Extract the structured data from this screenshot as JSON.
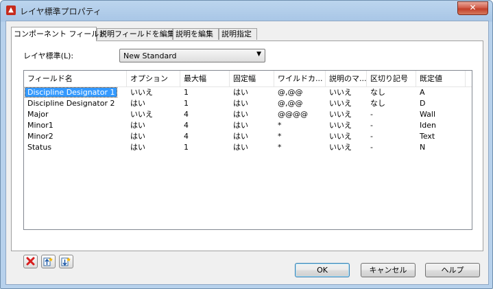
{
  "window": {
    "title": "レイヤ標準プロパティ",
    "close_label": "✕"
  },
  "tabs": [
    {
      "label": "コンポーネント フィールド",
      "active": true
    },
    {
      "label": "説明フィールドを編集",
      "active": false
    },
    {
      "label": "説明を編集",
      "active": false
    },
    {
      "label": "説明指定",
      "active": false
    }
  ],
  "layer_standard": {
    "label": "レイヤ標準(L):",
    "value": "New Standard"
  },
  "fields_table": {
    "columns": [
      "フィールド名",
      "オプション",
      "最大幅",
      "固定幅",
      "ワイルドカ...",
      "説明のマ...",
      "区切り記号",
      "既定値"
    ],
    "rows": [
      [
        "Discipline Designator 1",
        "いいえ",
        "1",
        "はい",
        "@,@@",
        "いいえ",
        "なし",
        "A"
      ],
      [
        "Discipline Designator 2",
        "はい",
        "1",
        "はい",
        "@,@@",
        "いいえ",
        "なし",
        "D"
      ],
      [
        "Major",
        "いいえ",
        "4",
        "はい",
        "@@@@",
        "いいえ",
        "-",
        "Wall"
      ],
      [
        "Minor1",
        "はい",
        "4",
        "はい",
        "*",
        "いいえ",
        "-",
        "Iden"
      ],
      [
        "Minor2",
        "はい",
        "4",
        "はい",
        "*",
        "いいえ",
        "-",
        "Text"
      ],
      [
        "Status",
        "はい",
        "1",
        "はい",
        "*",
        "いいえ",
        "-",
        "N"
      ]
    ],
    "selected_row": 0
  },
  "icon_buttons": [
    "delete-icon",
    "move-up-icon",
    "move-down-icon"
  ],
  "buttons": {
    "ok": "OK",
    "cancel": "キャンセル",
    "help": "ヘルプ"
  },
  "colors": {
    "selection": "#3399ff",
    "delete_icon": "#d81e1e",
    "app_icon": "#c62b1d"
  }
}
